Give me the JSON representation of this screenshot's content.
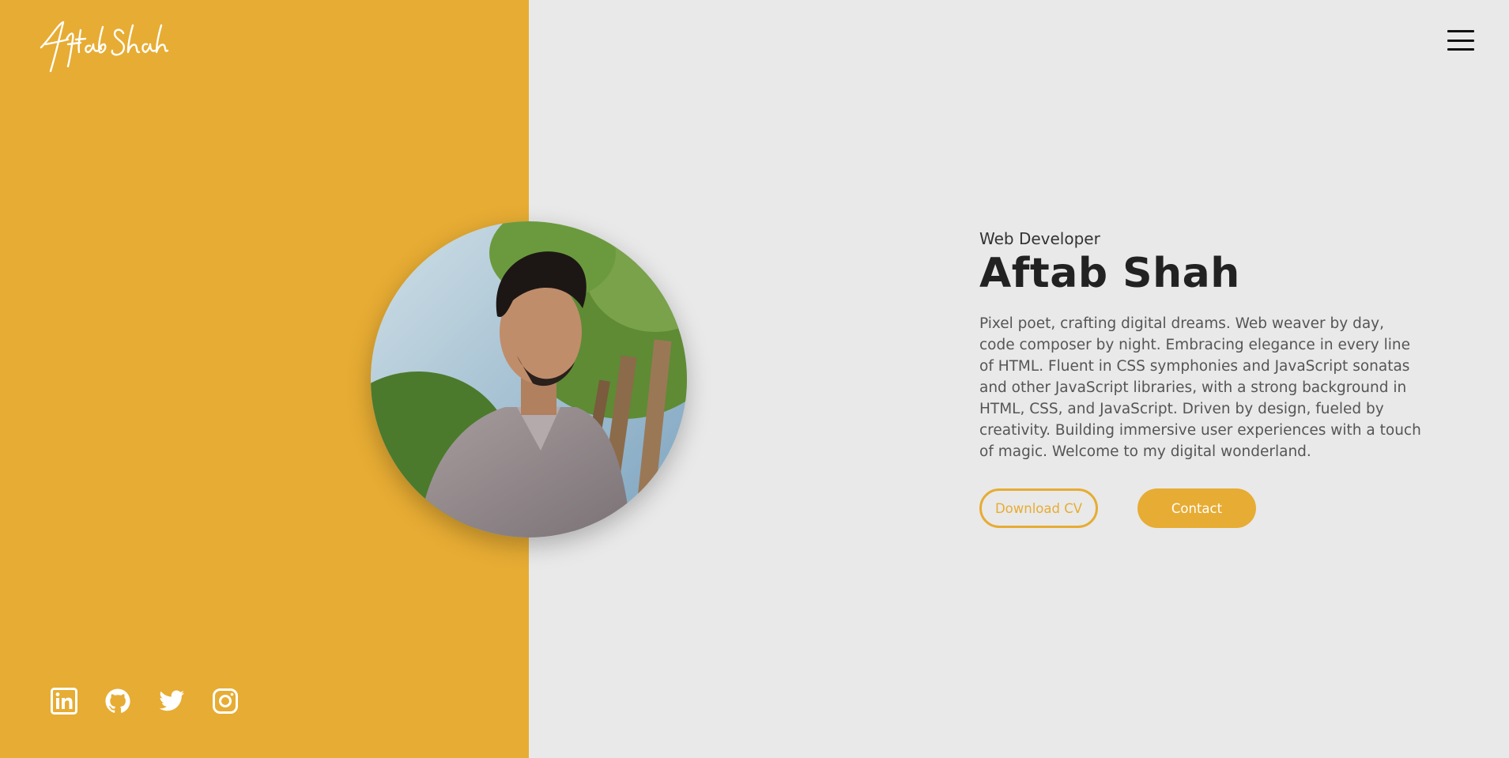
{
  "brand": {
    "logo_text": "Aftab Shah"
  },
  "header": {
    "menu_icon": "hamburger-menu-icon"
  },
  "hero": {
    "role": "Web Developer",
    "name": "Aftab Shah",
    "bio": "Pixel poet, crafting digital dreams. Web weaver by day, code composer by night. Embracing elegance in every line of HTML. Fluent in CSS symphonies and JavaScript sonatas and other JavaScript libraries, with a strong background in HTML, CSS, and JavaScript. Driven by design, fueled by creativity. Building immersive user experiences with a touch of magic. Welcome to my digital wonderland.",
    "download_label": "Download CV",
    "contact_label": "Contact"
  },
  "socials": [
    {
      "icon": "linkedin-icon"
    },
    {
      "icon": "github-icon"
    },
    {
      "icon": "twitter-icon"
    },
    {
      "icon": "instagram-icon"
    }
  ],
  "colors": {
    "accent": "#e7ac33",
    "background": "#e9e9e9",
    "text": "#222222"
  }
}
